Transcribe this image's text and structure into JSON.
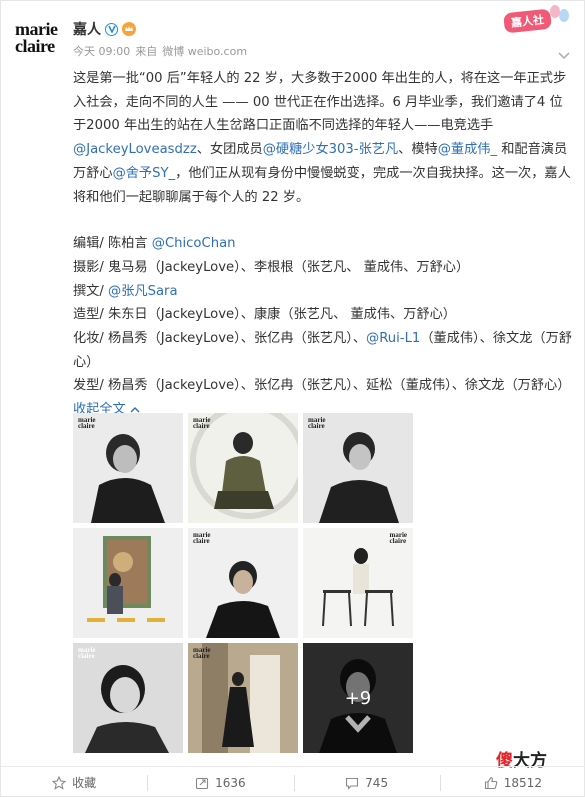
{
  "logo": {
    "line1": "marie",
    "line2": "claire"
  },
  "user": {
    "name": "嘉人"
  },
  "meta": {
    "time": "今天 09:00",
    "source_prefix": "来自",
    "source": "微博 weibo.com"
  },
  "sticker": {
    "label": "嘉人社"
  },
  "post": {
    "intro_1": "这是第一批“00 后”年轻人的 22 岁，大多数于2000 年出生的人，将在这一年正式步入社会，走向不同的人生 —— 00 世代正在作出选择。6 月毕业季，我们邀请了4 位于2000 年出生的站在人生岔路口正面临不同选择的年轻人——电竞选手",
    "mention_1": "@JackeyLoveasdzz",
    "intro_2": "、女团成员",
    "mention_2": "@硬糖少女303-张艺凡",
    "intro_3": "、模特",
    "mention_3": "@董成伟_",
    "intro_4": " 和配音演员万舒心",
    "mention_4": "@舍予SY_",
    "intro_5": "，他们正从现有身份中慢慢蜕变，完成一次自我抉择。这一次，嘉人将和他们一起聊聊属于每个人的 22 岁。",
    "editor_label": "编辑/ 陈柏言 ",
    "editor_mention": "@ChicoChan",
    "photo_line": "摄影/ 鬼马易（JackeyLove）、李根根（张艺凡、 董成伟、万舒心）",
    "writer_label": "撰文/ ",
    "writer_mention": "@张凡Sara",
    "styling_line": "造型/ 朱东日（JackeyLove）、康康（张艺凡、 董成伟、万舒心）",
    "makeup_1": "化妆/ 杨昌秀（JackeyLove）、张亿冉（张艺凡）、",
    "makeup_mention": "@Rui-L1",
    "makeup_2": "（董成伟）、徐文龙（万舒心）",
    "hair_line": "发型/ 杨昌秀（JackeyLove）、张亿冉（张艺凡）、延松（董成伟）、徐文龙（万舒心）",
    "collapse_label": "收起全文"
  },
  "photos": {
    "mag_line1": "marie",
    "mag_line2": "claire",
    "more_count": "+9"
  },
  "watermark": {
    "part1": "傻",
    "part2": "大方"
  },
  "footer": {
    "favorite_label": "收藏",
    "repost_count": "1636",
    "comment_count": "745",
    "like_count": "18512"
  },
  "colors": {
    "link": "#2f6fba",
    "verified": "#2a8bd6",
    "sticker": "#f05a76",
    "watermark_red": "#e0252b"
  }
}
